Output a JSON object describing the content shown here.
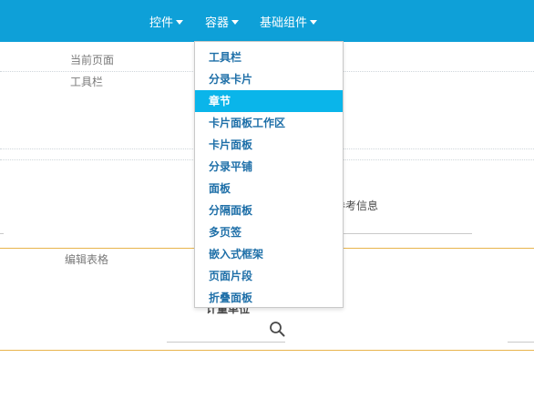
{
  "nav": {
    "items": [
      {
        "label": "控件"
      },
      {
        "label": "容器"
      },
      {
        "label": "基础组件"
      }
    ]
  },
  "colors": {
    "topbar": "#0ea0d8",
    "menu_active": "#0ab5ea",
    "menu_text": "#1e6fa8",
    "divider_orange": "#e8b44c"
  },
  "page": {
    "current_page_label": "当前页面",
    "toolbar_label": "工具栏",
    "reference_info_label": "参考信息",
    "edit_table_label": "编辑表格",
    "partial_label": "计量单位",
    "search_icon": "search-icon"
  },
  "menu": {
    "active_index": 2,
    "items": [
      {
        "label": "工具栏"
      },
      {
        "label": "分录卡片"
      },
      {
        "label": "章节"
      },
      {
        "label": "卡片面板工作区"
      },
      {
        "label": "卡片面板"
      },
      {
        "label": "分录平铺"
      },
      {
        "label": "面板"
      },
      {
        "label": "分隔面板"
      },
      {
        "label": "多页签"
      },
      {
        "label": "嵌入式框架"
      },
      {
        "label": "页面片段"
      },
      {
        "label": "折叠面板"
      }
    ]
  }
}
